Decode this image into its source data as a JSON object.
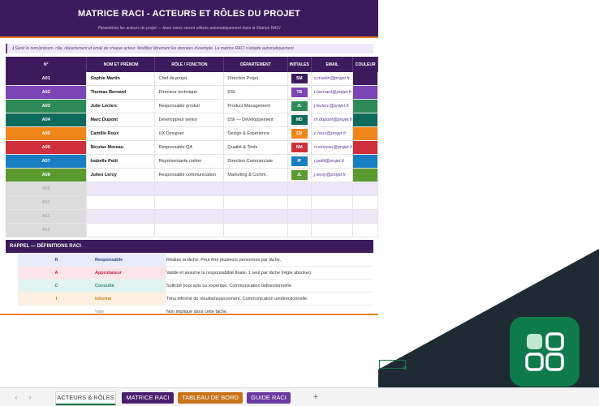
{
  "banner": {
    "title": "MATRICE RACI - ACTEURS ET RÔLES DU PROJET",
    "subtitle": "Paramétrez les acteurs du projet — leurs noms seront utilisés automatiquement dans la Matrice RACI"
  },
  "info": "ℹ Saisir le nom/prénom, rôle, département et email de chaque acteur. Modifiez librement les données d'exemple. La matrice RACI s'adapte automatiquement.",
  "columns": [
    "N°",
    "NOM ET PRÉNOM",
    "RÔLE / FONCTION",
    "DÉPARTEMENT",
    "INITIALES",
    "EMAIL",
    "COULEUR"
  ],
  "actors": [
    {
      "code": "A01",
      "name": "Sophie Martin",
      "role": "Chef de projet",
      "dept": "Direction Projet",
      "initials": "SM",
      "email": "s.martin@projet.fr",
      "color": "#3d1a5c"
    },
    {
      "code": "A02",
      "name": "Thomas Bernard",
      "role": "Directeur technique",
      "dept": "DSI",
      "initials": "TB",
      "email": "t.bernard@projet.fr",
      "color": "#7b45b5"
    },
    {
      "code": "A03",
      "name": "Julie Leclerc",
      "role": "Responsable produit",
      "dept": "Product Management",
      "initials": "JL",
      "email": "j.leclerc@projet.fr",
      "color": "#2e8b57"
    },
    {
      "code": "A04",
      "name": "Marc Dupont",
      "role": "Développeur senior",
      "dept": "DSI — Développement",
      "initials": "MD",
      "email": "m.dupont@projet.fr",
      "color": "#0e6b5c"
    },
    {
      "code": "A05",
      "name": "Camille Roux",
      "role": "UX Designer",
      "dept": "Design & Expérience",
      "initials": "CR",
      "email": "c.roux@projet.fr",
      "color": "#f0861a"
    },
    {
      "code": "A06",
      "name": "Nicolas Moreau",
      "role": "Responsable QA",
      "dept": "Qualité & Tests",
      "initials": "NM",
      "email": "n.moreau@projet.fr",
      "color": "#cf2f3a"
    },
    {
      "code": "A07",
      "name": "Isabelle Petit",
      "role": "Représentante métier",
      "dept": "Direction Commerciale",
      "initials": "IP",
      "email": "i.petit@projet.fr",
      "color": "#1a7ec3"
    },
    {
      "code": "A08",
      "name": "Julien Leroy",
      "role": "Responsable communication",
      "dept": "Marketing & Comm.",
      "initials": "JL",
      "email": "j.leroy@projet.fr",
      "color": "#5a9a2e"
    }
  ],
  "empty_codes": [
    "A09",
    "A10",
    "A11",
    "A12"
  ],
  "raci_heading": "RAPPEL — DÉFINITIONS RACI",
  "raci": [
    {
      "letter": "R",
      "name": "Responsable",
      "desc": "Réalise la tâche. Peut être plusieurs personnes par tâche.",
      "color": "#2a3f9e",
      "bg": "#e8ecfa"
    },
    {
      "letter": "A",
      "name": "Approbateur",
      "desc": "Valide et assume la responsabilité finale. 1 seul par tâche (règle absolue).",
      "color": "#c8204f",
      "bg": "#fbe4ea"
    },
    {
      "letter": "C",
      "name": "Consulté",
      "desc": "Sollicité pour avis ou expertise. Communication bidirectionnelle.",
      "color": "#2a8a7a",
      "bg": "#e0f3ef"
    },
    {
      "letter": "I",
      "name": "Informé",
      "desc": "Tenu informé du résultat/avancement. Communication unidirectionnelle.",
      "color": "#d77a12",
      "bg": "#fdf0e0"
    },
    {
      "letter": "",
      "name": "Vide",
      "desc": "Non impliqué dans cette tâche.",
      "color": "#888888",
      "bg": "#ffffff"
    }
  ],
  "tabs": [
    {
      "label": "ACTEURS & RÔLES",
      "color": "#ffffff",
      "active": true
    },
    {
      "label": "MATRICE RACI",
      "color": "#4a1f6e",
      "active": false
    },
    {
      "label": "TABLEAU DE BORD",
      "color": "#c8741a",
      "active": false
    },
    {
      "label": "GUIDE RACI",
      "color": "#6a3aa0",
      "active": false
    }
  ],
  "icons": {
    "add_sheet": "plus-icon",
    "prev": "chevron-left-icon",
    "next": "chevron-right-icon",
    "app": "grid-apps-icon"
  },
  "add_tab_label": "+",
  "nav_prev": "‹",
  "nav_next": "›"
}
